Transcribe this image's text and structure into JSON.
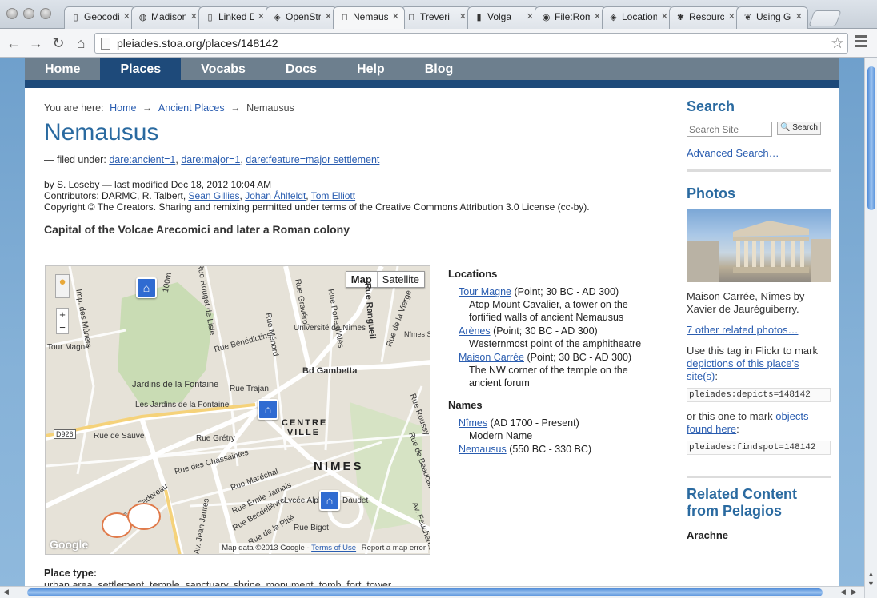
{
  "browser": {
    "tabs": [
      {
        "label": "Geocoding",
        "icon": "page-icon"
      },
      {
        "label": "Madison",
        "icon": "globe-icon"
      },
      {
        "label": "Linked Data",
        "icon": "page-icon"
      },
      {
        "label": "OpenStreetMap",
        "icon": "map-icon"
      },
      {
        "label": "Nemausus",
        "icon": "pleiades-icon",
        "active": true
      },
      {
        "label": "Treveri",
        "icon": "pleiades-icon"
      },
      {
        "label": "Volga",
        "icon": "bars-icon"
      },
      {
        "label": "File:Roman",
        "icon": "wiki-icon"
      },
      {
        "label": "Location",
        "icon": "map-icon"
      },
      {
        "label": "Resources",
        "icon": "star-icon"
      },
      {
        "label": "Using Git",
        "icon": "leaf-icon"
      }
    ],
    "url": "pleiades.stoa.org/places/148142"
  },
  "nav": {
    "items": [
      "Home",
      "Places",
      "Vocabs",
      "Docs",
      "Help",
      "Blog"
    ]
  },
  "breadcrumb": {
    "prefix": "You are here:",
    "home": "Home",
    "section": "Ancient Places",
    "current": "Nemausus",
    "sep": "→"
  },
  "place": {
    "title": "Nemausus",
    "filed_prefix": "— filed under:",
    "tags": [
      "dare:ancient=1",
      "dare:major=1",
      "dare:feature=major settlement"
    ],
    "byline": "by S. Loseby — last modified Dec 18, 2012 10:04 AM",
    "contributors_prefix": "Contributors: DARMC, R. Talbert,",
    "contributors_links": [
      "Sean Gillies",
      "Johan Åhlfeldt",
      "Tom Elliott"
    ],
    "copyright": "Copyright © The Creators. Sharing and remixing permitted under terms of the Creative Commons Attribution 3.0 License (cc-by).",
    "description": "Capital of the Volcae Arecomici and later a Roman colony",
    "place_type_label": "Place type:",
    "place_type_value": "urban area, settlement, temple, sanctuary, shrine, monument, tomb, fort, tower"
  },
  "map": {
    "toggle_map": "Map",
    "toggle_satellite": "Satellite",
    "footer_data": "Map data ©2013 Google",
    "footer_terms": "Terms of Use",
    "footer_report": "Report a map error",
    "google": "Google",
    "city_label": "NIMES",
    "centre_label": "CENTRE VILLE",
    "labels": [
      "Bd Gambetta",
      "Jardins de la Fontaine",
      "Les Jardins de la Fontaine",
      "Tour Magné",
      "Université de Nîmes",
      "Lycée Alphonse Daudet",
      "Rue de Sauve",
      "Rue Grétry",
      "Rue Trajan",
      "Rue Ménard",
      "Rue Bénédictins",
      "Rue Rangueil",
      "Rue Porte d'Alès",
      "Rue de la Vierge",
      "D926",
      "Av. Jean Jaurès",
      "Rue des Chassaintes",
      "Rue Maréchal",
      "Rue Bigot",
      "Rue du Cadereau",
      "Rue Gravérol",
      "Rue Rouget de Lisle",
      "Imp. des Mûriers",
      "Rue Émile Jamais",
      "Rue Becdelièvre",
      "Rue de la Pitié",
      "100m",
      "Nîmes St Gilles",
      "Rue Roussy",
      "Rue de Beaucaire",
      "Av. Feuchères"
    ]
  },
  "locations": {
    "heading": "Locations",
    "items": [
      {
        "name": "Tour Magne",
        "meta": "(Point; 30 BC - AD 300)",
        "desc": "Atop Mount Cavalier, a tower on the fortified walls of ancient Nemausus"
      },
      {
        "name": "Arènes",
        "meta": "(Point; 30 BC - AD 300)",
        "desc": "Westernmost point of the amphitheatre"
      },
      {
        "name": "Maison Carrée",
        "meta": "(Point; 30 BC - AD 300)",
        "desc": "The NW corner of the temple on the ancient forum"
      }
    ]
  },
  "names": {
    "heading": "Names",
    "items": [
      {
        "name": "Nîmes",
        "meta": "(AD 1700 - Present)",
        "desc": "Modern Name"
      },
      {
        "name": "Nemausus",
        "meta": "(550 BC - 330 BC)",
        "desc": ""
      }
    ]
  },
  "sidebar": {
    "search_heading": "Search",
    "search_placeholder": "Search Site",
    "search_button": "Search",
    "advanced": "Advanced Search…",
    "photos_heading": "Photos",
    "photo_caption": "Maison Carrée, Nîmes by Xavier de Jauréguiberry.",
    "related_photos": "7 other related photos…",
    "flickr_text1": "Use this tag in Flickr to mark",
    "flickr_link1": "depictions of this place's site(s)",
    "depicts_tag": "pleiades:depicts=148142",
    "flickr_text2": "or this one to mark",
    "flickr_link2": "objects found here",
    "findspot_tag": "pleiades:findspot=148142",
    "related_heading": "Related Content from Pelagios",
    "related_first": "Arachne"
  },
  "colors": {
    "nav_bg": "#6d7f8e",
    "nav_active": "#1e4a7a",
    "heading": "#2a6aa0",
    "link": "#2a5db0",
    "page_bg": "#86b2d8"
  }
}
